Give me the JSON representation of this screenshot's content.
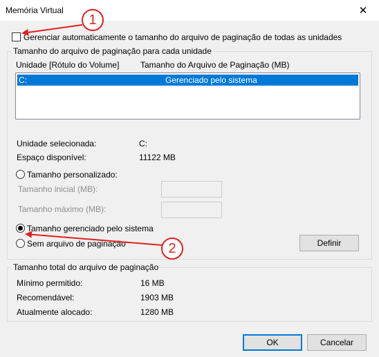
{
  "window": {
    "title": "Memória Virtual",
    "close_glyph": "✕"
  },
  "auto_manage": {
    "label": "Gerenciar automaticamente o tamanho do arquivo de paginação de todas as unidades",
    "checked": false
  },
  "per_drive_group": {
    "legend": "Tamanho do arquivo de paginação para cada unidade",
    "col_drive": "Unidade [Rótulo do Volume]",
    "col_size": "Tamanho do Arquivo de Paginação (MB)",
    "rows": [
      {
        "drive": "C:",
        "size": "Gerenciado pelo sistema"
      }
    ],
    "selected_drive_label": "Unidade selecionada:",
    "selected_drive_value": "C:",
    "free_space_label": "Espaço disponível:",
    "free_space_value": "11122 MB",
    "custom_size_label": "Tamanho personalizado:",
    "initial_size_label": "Tamanho inicial (MB):",
    "max_size_label": "Tamanho máximo (MB):",
    "system_managed_label": "Tamanho gerenciado pelo sistema",
    "no_paging_label": "Sem arquivo de paginação",
    "set_button": "Definir",
    "selected_option": "system_managed"
  },
  "total_group": {
    "legend": "Tamanho total do arquivo de paginação",
    "min_label": "Mínimo permitido:",
    "min_value": "16 MB",
    "recommended_label": "Recomendável:",
    "recommended_value": "1903 MB",
    "allocated_label": "Atualmente alocado:",
    "allocated_value": "1280 MB"
  },
  "buttons": {
    "ok": "OK",
    "cancel": "Cancelar"
  },
  "annotations": {
    "callout_1": "1",
    "callout_2": "2",
    "color": "#e02020"
  }
}
